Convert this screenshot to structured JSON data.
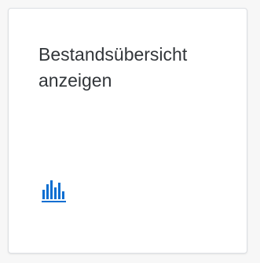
{
  "tile": {
    "title_line1": "Bestandsübersicht",
    "title_line2": "anzeigen",
    "icon": "bar-chart-icon",
    "accent_color": "#0a6ed1"
  }
}
